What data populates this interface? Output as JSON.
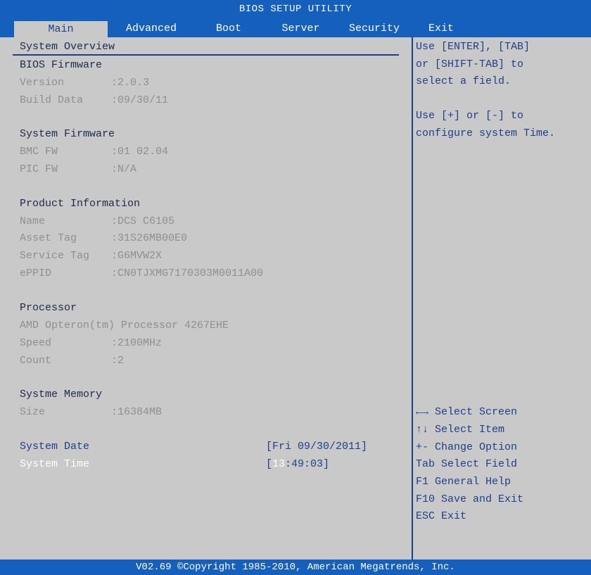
{
  "title": "BIOS SETUP UTILITY",
  "tabs": [
    "Main",
    "Advanced",
    "Boot",
    "Server",
    "Security",
    "Exit"
  ],
  "overview": {
    "heading": "System Overview",
    "bios_heading": "BIOS Firmware",
    "version_label": "Version",
    "version_value": ":2.0.3",
    "build_label": "Build Data",
    "build_value": ":09/30/11",
    "sysfw_heading": "System Firmware",
    "bmc_label": "BMC FW",
    "bmc_value": ":01 02.04",
    "pic_label": "PIC FW",
    "pic_value": ":N/A",
    "product_heading": "Product Information",
    "name_label": "Name",
    "name_value": ":DCS C6105",
    "asset_label": "Asset Tag",
    "asset_value": ":31S26MB00E0",
    "service_label": "Service Tag",
    "service_value": ":G6MVW2X",
    "eppid_label": "ePPID",
    "eppid_value": ":CN0TJXMG7170303M0011A00",
    "processor_heading": "Processor",
    "processor_name": "AMD Opteron(tm) Processor 4267EHE",
    "speed_label": "Speed",
    "speed_value": ":2100MHz",
    "count_label": "Count",
    "count_value": ":2",
    "memory_heading": "Systme Memory",
    "size_label": "Size",
    "size_value": ":16384MB",
    "date_label": "System Date",
    "date_value": "[Fri 09/30/2011]",
    "time_label": "System Time",
    "time_open": "[",
    "time_hour": "13",
    "time_rest": ":49:03]"
  },
  "help": {
    "lines_top": [
      "Use [ENTER], [TAB]",
      "or [SHIFT-TAB] to",
      "select a field.",
      "",
      "Use [+] or [-] to",
      "configure system Time."
    ],
    "lines_keys": [
      "←→ Select Screen",
      "↑↓ Select Item",
      "+- Change Option",
      "Tab Select Field",
      "F1  General Help",
      "F10 Save and Exit",
      "ESC Exit"
    ]
  },
  "footer": "V02.69 ©Copyright 1985-2010, American Megatrends, Inc.",
  "colors": {
    "bar": "#1560bd",
    "panel": "#c9c9c9",
    "accent": "#1e3f8a",
    "disabled": "#8f8f8f"
  }
}
